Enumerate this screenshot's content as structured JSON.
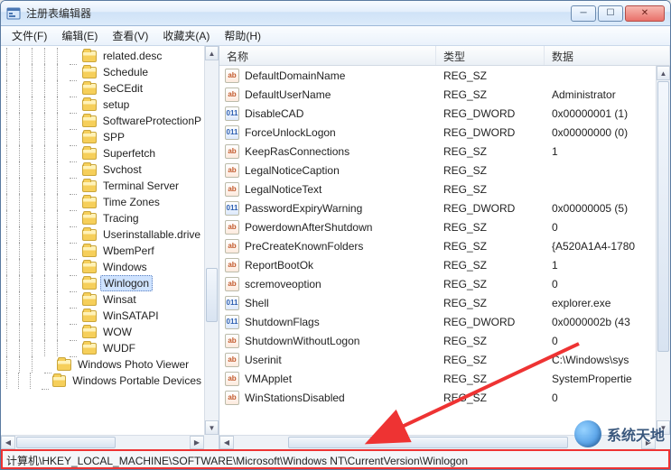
{
  "window": {
    "title": "注册表编辑器"
  },
  "menu": {
    "file": "文件(F)",
    "edit": "编辑(E)",
    "view": "查看(V)",
    "favorites": "收藏夹(A)",
    "help": "帮助(H)"
  },
  "tree": {
    "items": [
      {
        "label": "related.desc",
        "depth": 5
      },
      {
        "label": "Schedule",
        "depth": 5
      },
      {
        "label": "SeCEdit",
        "depth": 5
      },
      {
        "label": "setup",
        "depth": 5
      },
      {
        "label": "SoftwareProtectionP",
        "depth": 5
      },
      {
        "label": "SPP",
        "depth": 5
      },
      {
        "label": "Superfetch",
        "depth": 5
      },
      {
        "label": "Svchost",
        "depth": 5
      },
      {
        "label": "Terminal Server",
        "depth": 5
      },
      {
        "label": "Time Zones",
        "depth": 5
      },
      {
        "label": "Tracing",
        "depth": 5
      },
      {
        "label": "Userinstallable.drive",
        "depth": 5
      },
      {
        "label": "WbemPerf",
        "depth": 5
      },
      {
        "label": "Windows",
        "depth": 5
      },
      {
        "label": "Winlogon",
        "depth": 5,
        "selected": true
      },
      {
        "label": "Winsat",
        "depth": 5
      },
      {
        "label": "WinSATAPI",
        "depth": 5
      },
      {
        "label": "WOW",
        "depth": 5
      },
      {
        "label": "WUDF",
        "depth": 5
      },
      {
        "label": "Windows Photo Viewer",
        "depth": 3
      },
      {
        "label": "Windows Portable Devices",
        "depth": 3
      }
    ]
  },
  "list": {
    "headers": {
      "name": "名称",
      "type": "类型",
      "data": "数据"
    },
    "rows": [
      {
        "icon": "str",
        "name": "DefaultDomainName",
        "type": "REG_SZ",
        "data": ""
      },
      {
        "icon": "str",
        "name": "DefaultUserName",
        "type": "REG_SZ",
        "data": "Administrator"
      },
      {
        "icon": "bin",
        "name": "DisableCAD",
        "type": "REG_DWORD",
        "data": "0x00000001 (1)"
      },
      {
        "icon": "bin",
        "name": "ForceUnlockLogon",
        "type": "REG_DWORD",
        "data": "0x00000000 (0)"
      },
      {
        "icon": "str",
        "name": "KeepRasConnections",
        "type": "REG_SZ",
        "data": "1"
      },
      {
        "icon": "str",
        "name": "LegalNoticeCaption",
        "type": "REG_SZ",
        "data": ""
      },
      {
        "icon": "str",
        "name": "LegalNoticeText",
        "type": "REG_SZ",
        "data": ""
      },
      {
        "icon": "bin",
        "name": "PasswordExpiryWarning",
        "type": "REG_DWORD",
        "data": "0x00000005 (5)"
      },
      {
        "icon": "str",
        "name": "PowerdownAfterShutdown",
        "type": "REG_SZ",
        "data": "0"
      },
      {
        "icon": "str",
        "name": "PreCreateKnownFolders",
        "type": "REG_SZ",
        "data": "{A520A1A4-1780"
      },
      {
        "icon": "str",
        "name": "ReportBootOk",
        "type": "REG_SZ",
        "data": "1"
      },
      {
        "icon": "str",
        "name": "scremoveoption",
        "type": "REG_SZ",
        "data": "0"
      },
      {
        "icon": "bin",
        "name": "Shell",
        "type": "REG_SZ",
        "data": "explorer.exe"
      },
      {
        "icon": "bin",
        "name": "ShutdownFlags",
        "type": "REG_DWORD",
        "data": "0x0000002b (43"
      },
      {
        "icon": "str",
        "name": "ShutdownWithoutLogon",
        "type": "REG_SZ",
        "data": "0"
      },
      {
        "icon": "str",
        "name": "Userinit",
        "type": "REG_SZ",
        "data": "C:\\Windows\\sys"
      },
      {
        "icon": "str",
        "name": "VMApplet",
        "type": "REG_SZ",
        "data": "SystemPropertie"
      },
      {
        "icon": "str",
        "name": "WinStationsDisabled",
        "type": "REG_SZ",
        "data": "0"
      }
    ]
  },
  "status": {
    "path": "计算机\\HKEY_LOCAL_MACHINE\\SOFTWARE\\Microsoft\\Windows NT\\CurrentVersion\\Winlogon"
  },
  "watermark": {
    "text": "系统天地"
  },
  "icons": {
    "str_glyph": "ab",
    "bin_glyph": "011"
  }
}
